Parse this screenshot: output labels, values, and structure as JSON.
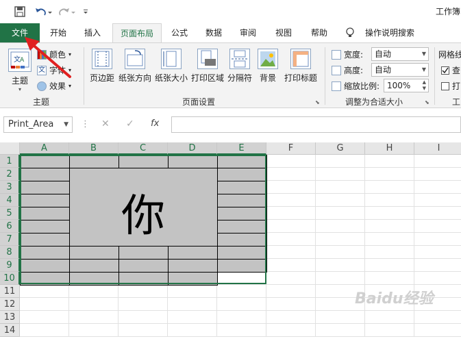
{
  "title_bar": {
    "title": "工作簿"
  },
  "tabs": [
    "文件",
    "开始",
    "插入",
    "页面布局",
    "公式",
    "数据",
    "审阅",
    "视图",
    "帮助",
    "操作说明搜索"
  ],
  "ribbon": {
    "themes": {
      "big_label": "主题",
      "colors": "颜色",
      "fonts": "字体",
      "effects": "效果",
      "group": "主题"
    },
    "page_setup": {
      "margins": "页边距",
      "orientation": "纸张方向",
      "size": "纸张大小",
      "print_area": "打印区域",
      "breaks": "分隔符",
      "background": "背景",
      "print_titles": "打印标题",
      "group": "页面设置"
    },
    "scale": {
      "width_label": "宽度:",
      "width_value": "自动",
      "height_label": "高度:",
      "height_value": "自动",
      "scale_label": "缩放比例:",
      "scale_value": "100%",
      "group": "调整为合适大小"
    },
    "sheet_options": {
      "gridlines": "网格线",
      "view": "查",
      "print": "打",
      "group": "工"
    }
  },
  "formula_bar": {
    "name_box": "Print_Area",
    "fx": "fx",
    "value": ""
  },
  "grid": {
    "columns": [
      "A",
      "B",
      "C",
      "D",
      "E",
      "F",
      "G",
      "H",
      "I"
    ],
    "rows": [
      "1",
      "2",
      "3",
      "4",
      "5",
      "6",
      "7",
      "8",
      "9",
      "10",
      "11",
      "12",
      "13",
      "14"
    ],
    "merged_text": "你"
  },
  "watermark": "Baidu经验"
}
